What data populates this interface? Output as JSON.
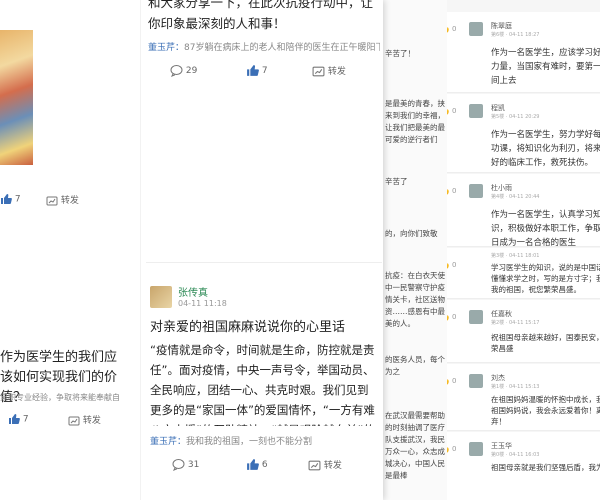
{
  "right_panel": {
    "comments": [
      {
        "name": "陈翠庭",
        "meta": "第6楼 · 04-11 18:27",
        "likes": "0",
        "text": "作为一名医学生，应该学习好的力量，当国家有难时，要第一时间上去"
      },
      {
        "name": "程凯",
        "meta": "第5楼 · 04-11 20:29",
        "likes": "0",
        "text": "作为一名医学生，努力学好每门功课，将知识化为利刃，将来更好的临床工作，救死扶伤。"
      },
      {
        "name": "杜小雨",
        "meta": "第4楼 · 04-11 20:44",
        "likes": "0",
        "text": "作为一名医学生，认真学习知识，积极做好本职工作，争取早日成为一名合格的医生"
      },
      {
        "name": "",
        "meta": "第3楼 · 04-11 18:01",
        "likes": "0",
        "text": "学习医学生的知识，说的是中国话；懂懂求学之时，写的是方寸字；我爱我的祖国，祝您繁荣昌盛。"
      },
      {
        "name": "任嘉秋",
        "meta": "第2楼 · 04-11 15:17",
        "likes": "0",
        "text": "祝祖国母亲越来越好，国泰民安，繁荣昌盛"
      },
      {
        "name": "刘杰",
        "meta": "第1楼 · 04-11 15:13",
        "likes": "0",
        "text": "在祖国妈妈温暖的怀抱中成长，我对祖国妈妈说，我会永远爱着你！离不弃！"
      },
      {
        "name": "王玉华",
        "meta": "第0楼 · 04-11 16:03",
        "likes": "0",
        "text": "祖国母亲就是我们坚强后盾，我为"
      }
    ]
  },
  "middle_panel": {
    "rows": [
      {
        "text": "辛苦了！"
      },
      {
        "text": "是最美的青春，挟来到我们的幸福，让我们把最美的最可爱的逆行者们"
      },
      {
        "text": "辛苦了"
      },
      {
        "text": "的，向你们致敬"
      },
      {
        "text": "抗疫：在白衣天使中一民警察守护疫情关卡，社区送物资……感恩有中最美的人。"
      },
      {
        "text": "的医务人员，每个为之"
      },
      {
        "text": "在武汉最需要帮助的时刻抽调了医疗队支援武汉，我民万众一心，众志成城决心，中国人民是最棒"
      }
    ]
  },
  "main": {
    "top_card": {
      "body_tail": "和大家分享一下，在此次抗疫行动中，让你印象最深刻的人和事！",
      "tag_user": "董玉芹：",
      "tag_text": "87岁躺在病床上的老人和陪伴的医生在正午暖阳下",
      "comments": "29",
      "likes": "7",
      "share": "转发"
    },
    "left_top_stub": {
      "likes": "7",
      "share": "转发"
    },
    "left_bottom_card": {
      "title": "作为医学生的我们应该如何实现我们的价值？",
      "tag_text": "累积专业经验，争取将来能奉献自",
      "likes": "7",
      "share": "转发"
    },
    "post_card": {
      "author": "张传真",
      "time": "04-11 11:18",
      "title": "对亲爱的祖国麻麻说说你的心里话",
      "body": "“疫情就是命令，时间就是生命，防控就是责任”。面对疫情，中央一声号令，举国动员、全民响应，团结一心、共克时艰。我们见到更多的是“家国一体”的爱国情怀，“一方有难八方支援”的互助精神，“越是艰险越向前”的精气神…",
      "tag_user": "董玉芹：",
      "tag_text": "我和我的祖国，一刻也不能分割",
      "comments": "31",
      "likes": "6",
      "share": "转发"
    }
  }
}
